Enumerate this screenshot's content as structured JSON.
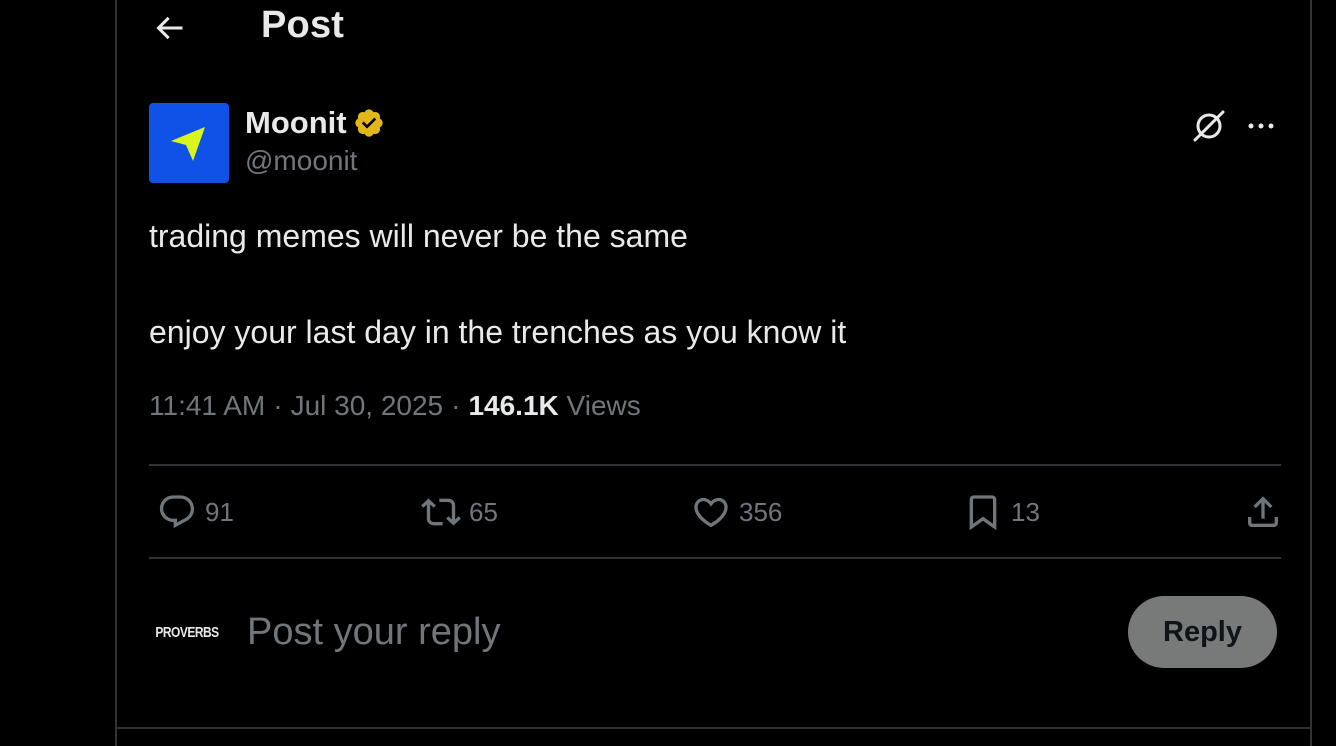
{
  "header": {
    "back_icon": "arrow-left-icon",
    "title": "Post"
  },
  "author": {
    "display_name": "Moonit",
    "handle": "@moonit",
    "verified": true,
    "verified_badge_color": "#e2b719",
    "avatar_bg_color": "#1152e6",
    "avatar_icon": "navigation-arrow-icon",
    "avatar_icon_color": "#d8f51d"
  },
  "post": {
    "paragraphs": [
      "trading memes will never be the same",
      "enjoy your last day in the trenches as you know it"
    ],
    "time": "11:41 AM",
    "date": "Jul 30, 2025",
    "separator": "·",
    "views_count": "146.1K",
    "views_label": "Views"
  },
  "actions": {
    "replies": "91",
    "reposts": "65",
    "likes": "356",
    "bookmarks": "13"
  },
  "reply_box": {
    "avatar_text": "PROVERBS",
    "placeholder": "Post your reply",
    "button_label": "Reply"
  },
  "colors": {
    "background": "#000000",
    "text_primary": "#e7e9ea",
    "text_secondary": "#71767b",
    "border": "#2f3336",
    "reply_button_bg": "#787a7a"
  }
}
